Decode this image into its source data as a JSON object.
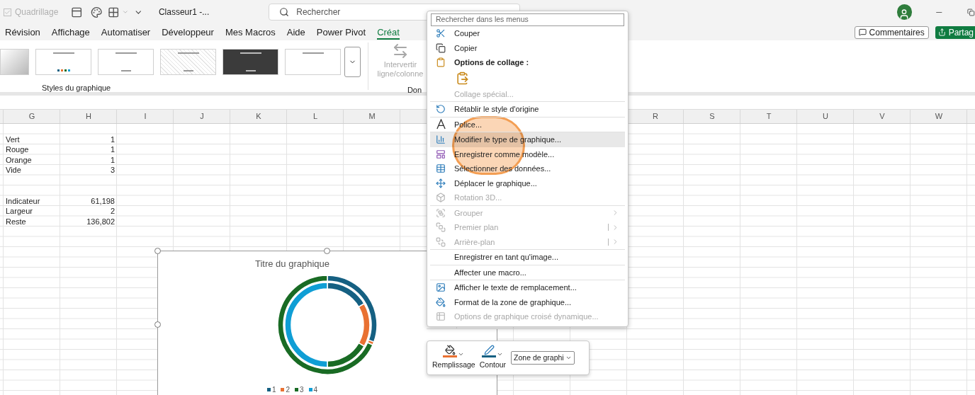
{
  "title_bar": {
    "gridlines": {
      "label": "Quadrillage",
      "checked": true,
      "disabled": true
    },
    "document_title": "Classeur1 -...",
    "search": {
      "placeholder": "Rechercher"
    }
  },
  "ribbon_tabs": [
    {
      "label": "Révision",
      "selected": false
    },
    {
      "label": "Affichage",
      "selected": false
    },
    {
      "label": "Automatiser",
      "selected": false
    },
    {
      "label": "Développeur",
      "selected": false
    },
    {
      "label": "Mes Macros",
      "selected": false
    },
    {
      "label": "Aide",
      "selected": false
    },
    {
      "label": "Power Pivot",
      "selected": false
    },
    {
      "label": "Créat",
      "selected": true
    }
  ],
  "ribbon_actions": {
    "comments": "Commentaires",
    "share": "Partag"
  },
  "ribbon": {
    "chart_styles": [
      {
        "kind": "gradient"
      },
      {
        "kind": "legend"
      },
      {
        "kind": "titled"
      },
      {
        "kind": "hatched"
      },
      {
        "kind": "dark"
      },
      {
        "kind": "plain"
      }
    ],
    "styles_group_label": "Styles du graphique",
    "switch_button": {
      "label": "Intervertir ligne/colonne",
      "disabled": true
    },
    "data_group_label": "Don"
  },
  "sheet": {
    "columns": [
      "G",
      "H",
      "I",
      "J",
      "K",
      "L",
      "M"
    ],
    "right_columns": [
      "R",
      "S",
      "T",
      "U",
      "V",
      "W"
    ],
    "blocks": [
      {
        "rows": [
          {
            "label": "Vert",
            "value": "1"
          },
          {
            "label": "Rouge",
            "value": "1"
          },
          {
            "label": "Orange",
            "value": "1"
          },
          {
            "label": "Vide",
            "value": "3"
          }
        ]
      },
      {
        "rows": [
          {
            "label": "Indicateur",
            "value": "61,198"
          },
          {
            "label": "Largeur",
            "value": "2"
          },
          {
            "label": "Reste",
            "value": "136,802"
          }
        ]
      }
    ]
  },
  "chart": {
    "chart_data": {
      "type": "donut",
      "title": "Titre du graphique",
      "legend": "bottom",
      "categories": [
        "1",
        "2",
        "3",
        "4"
      ],
      "colors": [
        "#156082",
        "#e97132",
        "#196b24",
        "#0f9ed5"
      ],
      "series": [
        {
          "values": [
            1,
            1,
            1,
            3
          ]
        },
        {
          "values": [
            61.198,
            2,
            136.802,
            null
          ]
        }
      ]
    }
  },
  "context_menu": {
    "search_placeholder": "Rechercher dans les menus",
    "groups": [
      {
        "items": [
          {
            "kind": "command",
            "label": "Couper",
            "disabled": false,
            "hovered": false,
            "submenu": false,
            "split": false
          },
          {
            "kind": "command",
            "label": "Copier",
            "disabled": false,
            "hovered": false,
            "submenu": false,
            "split": false
          },
          {
            "kind": "header",
            "label": "Options de collage :",
            "disabled": false,
            "hovered": false,
            "submenu": false,
            "split": false
          },
          {
            "kind": "paste-option",
            "disabled": false,
            "hovered": false,
            "submenu": false,
            "split": false
          },
          {
            "kind": "command",
            "label": "Collage spécial...",
            "disabled": true,
            "hovered": false,
            "submenu": false,
            "split": false
          }
        ]
      },
      {
        "items": [
          {
            "kind": "command",
            "label": "Rétablir le style d'origine",
            "disabled": false,
            "hovered": false,
            "submenu": false,
            "split": false
          }
        ]
      },
      {
        "items": [
          {
            "kind": "command",
            "label": "Police...",
            "disabled": false,
            "hovered": false,
            "submenu": false,
            "split": false
          }
        ]
      },
      {
        "items": [
          {
            "kind": "command",
            "label": "Modifier le type de graphique...",
            "disabled": false,
            "hovered": true,
            "submenu": false,
            "split": false
          },
          {
            "kind": "command",
            "label": "Enregistrer comme modèle...",
            "disabled": false,
            "hovered": false,
            "submenu": false,
            "split": false
          },
          {
            "kind": "command",
            "label": "Sélectionner des données...",
            "disabled": false,
            "hovered": false,
            "submenu": false,
            "split": false
          },
          {
            "kind": "command",
            "label": "Déplacer le graphique...",
            "disabled": false,
            "hovered": false,
            "submenu": false,
            "split": false
          },
          {
            "kind": "command",
            "label": "Rotation 3D...",
            "disabled": true,
            "hovered": false,
            "submenu": false,
            "split": false
          }
        ]
      },
      {
        "items": [
          {
            "kind": "command",
            "label": "Grouper",
            "disabled": true,
            "hovered": false,
            "submenu": true,
            "split": false
          },
          {
            "kind": "command",
            "label": "Premier plan",
            "disabled": true,
            "hovered": false,
            "submenu": true,
            "split": true
          },
          {
            "kind": "command",
            "label": "Arrière-plan",
            "disabled": true,
            "hovered": false,
            "submenu": true,
            "split": true
          }
        ]
      },
      {
        "items": [
          {
            "kind": "command",
            "label": "Enregistrer en tant qu'image...",
            "disabled": false,
            "hovered": false,
            "submenu": false,
            "split": false
          }
        ]
      },
      {
        "items": [
          {
            "kind": "command",
            "label": "Affecter une macro...",
            "disabled": false,
            "hovered": false,
            "submenu": false,
            "split": false
          }
        ]
      },
      {
        "items": [
          {
            "kind": "command",
            "label": "Afficher le texte de remplacement...",
            "disabled": false,
            "hovered": false,
            "submenu": false,
            "split": false
          },
          {
            "kind": "command",
            "label": "Format de la zone de graphique...",
            "disabled": false,
            "hovered": false,
            "submenu": false,
            "split": false
          },
          {
            "kind": "command",
            "label": "Options de graphique croisé dynamique...",
            "disabled": true,
            "hovered": false,
            "submenu": false,
            "split": false
          }
        ]
      }
    ]
  },
  "mini_toolbar": {
    "buttons": [
      {
        "kind": "fill",
        "label": "Remplissage"
      },
      {
        "kind": "outline",
        "label": "Contour"
      }
    ],
    "element_select": {
      "value": "Zone de graphi"
    }
  }
}
